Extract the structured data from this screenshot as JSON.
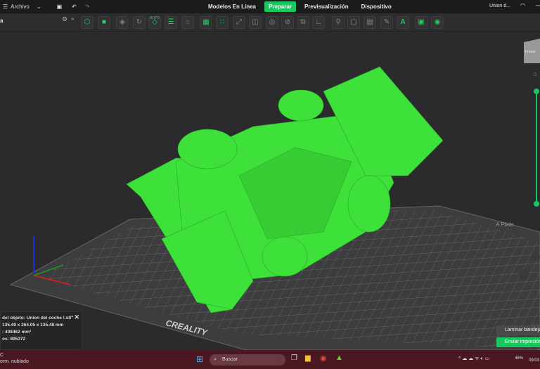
{
  "menu": {
    "file": "Archivo"
  },
  "tabs": [
    {
      "label": "Modelos En Línea"
    },
    {
      "label": "Preparar",
      "active": true
    },
    {
      "label": "Previsualización"
    },
    {
      "label": "Dispositivo"
    }
  ],
  "project_title": "Union d...",
  "left_panel_label": "a",
  "toolbar": {
    "auto_label": "AUTO"
  },
  "viewport": {
    "view_cube_label": "Frente",
    "plate_label": "A Plate",
    "bed_brand": "CREALITY",
    "model_color": "#3ee03a",
    "accent": "#18c75e"
  },
  "info": {
    "line1": "del objeto: Union del coche !.stl\"",
    "line2": "135.49 x 264.05 x 135.48 mm",
    "line3": ": 408462 mm³",
    "line4": "os: 895372"
  },
  "actions": {
    "slice": "Laminar bandeja",
    "send": "Enviar impresión"
  },
  "taskbar": {
    "weather1": "C",
    "weather2": "orm. nublado",
    "search": "Buscar",
    "battery": "46%",
    "date": "09/03"
  }
}
